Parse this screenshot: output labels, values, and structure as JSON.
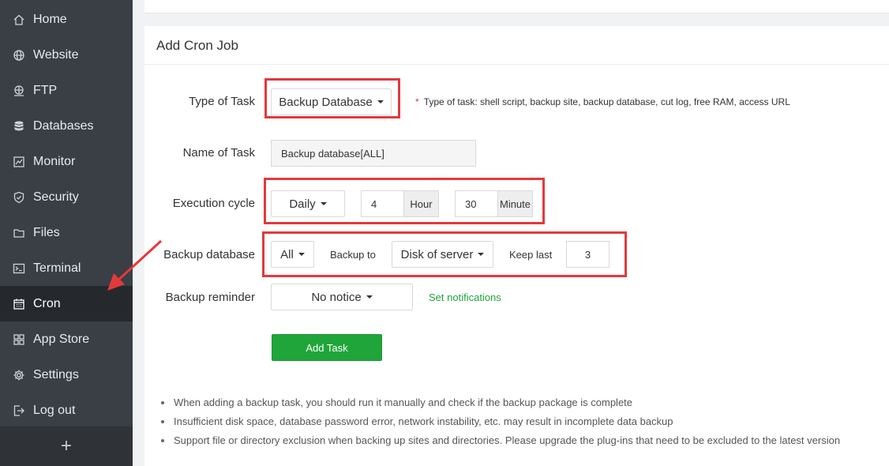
{
  "sidebar": {
    "items": [
      {
        "label": "Home",
        "icon": "home-icon"
      },
      {
        "label": "Website",
        "icon": "globe-icon"
      },
      {
        "label": "FTP",
        "icon": "ftp-icon"
      },
      {
        "label": "Databases",
        "icon": "database-icon"
      },
      {
        "label": "Monitor",
        "icon": "monitor-icon"
      },
      {
        "label": "Security",
        "icon": "shield-icon"
      },
      {
        "label": "Files",
        "icon": "folder-icon"
      },
      {
        "label": "Terminal",
        "icon": "terminal-icon"
      },
      {
        "label": "Cron",
        "icon": "calendar-icon"
      },
      {
        "label": "App Store",
        "icon": "grid-icon"
      },
      {
        "label": "Settings",
        "icon": "gear-icon"
      },
      {
        "label": "Log out",
        "icon": "logout-icon"
      }
    ],
    "active": "Cron",
    "add_label": "+"
  },
  "card": {
    "title": "Add Cron Job"
  },
  "form": {
    "type_label": "Type of Task",
    "type_value": "Backup Database",
    "type_hint_star": "*",
    "type_hint": "Type of task: shell script, backup site, backup database, cut log, free RAM, access URL",
    "name_label": "Name of Task",
    "name_value": "Backup database[ALL]",
    "cycle_label": "Execution cycle",
    "cycle_value": "Daily",
    "hour_value": "4",
    "hour_unit": "Hour",
    "minute_value": "30",
    "minute_unit": "Minute",
    "backup_db_label": "Backup database",
    "backup_db_value": "All",
    "backup_to_label": "Backup to",
    "backup_to_value": "Disk of server",
    "keep_last_label": "Keep last",
    "keep_last_value": "3",
    "reminder_label": "Backup reminder",
    "reminder_value": "No notice",
    "set_notifications": "Set notifications",
    "add_task": "Add Task"
  },
  "notes": [
    "When adding a backup task, you should run it manually and check if the backup package is complete",
    "Insufficient disk space, database password error, network instability, etc. may result in incomplete data backup",
    "Support file or directory exclusion when backing up sites and directories. Please upgrade the plug-ins that need to be excluded to the latest version"
  ],
  "colors": {
    "sidebar_bg": "#3a3f45",
    "accent_green": "#20a53a",
    "highlight_red": "#e4393c"
  }
}
